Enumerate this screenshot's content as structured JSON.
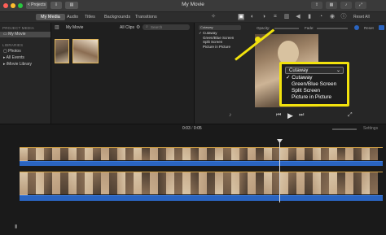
{
  "window": {
    "title": "My Movie",
    "projects_label": "< Projects",
    "reset_all_label": "Reset All"
  },
  "toolbar": {
    "tabs": [
      "My Media",
      "Audio",
      "Titles",
      "Backgrounds",
      "Transitions"
    ]
  },
  "sidebar": {
    "project_media_header": "PROJECT MEDIA",
    "project_item": "My Movie",
    "libraries_header": "LIBRARIES",
    "library_items": [
      "Photos",
      "All Events",
      "iMovie Library"
    ]
  },
  "browser": {
    "heading": "My Movie",
    "filter": "All Clips",
    "search_placeholder": "Search"
  },
  "viewer": {
    "mode_dropdown": "Cutaway",
    "opacity_label": "Opacity:",
    "fade_label": "Fade:",
    "reset_label": "Reset",
    "mode_options_small": [
      "Cutaway",
      "Green/Blue Screen",
      "Split Screen",
      "Picture in Picture"
    ]
  },
  "callout": {
    "selected": "Cutaway",
    "options": [
      "Cutaway",
      "Green/Blue Screen",
      "Split Screen",
      "Picture in Picture"
    ]
  },
  "timeline": {
    "current_time": "0:03",
    "total_time": "0:05",
    "settings_label": "Settings"
  },
  "colors": {
    "highlight": "#f2e20d",
    "clip_border": "#d9a646",
    "audio": "#2a64c0"
  }
}
